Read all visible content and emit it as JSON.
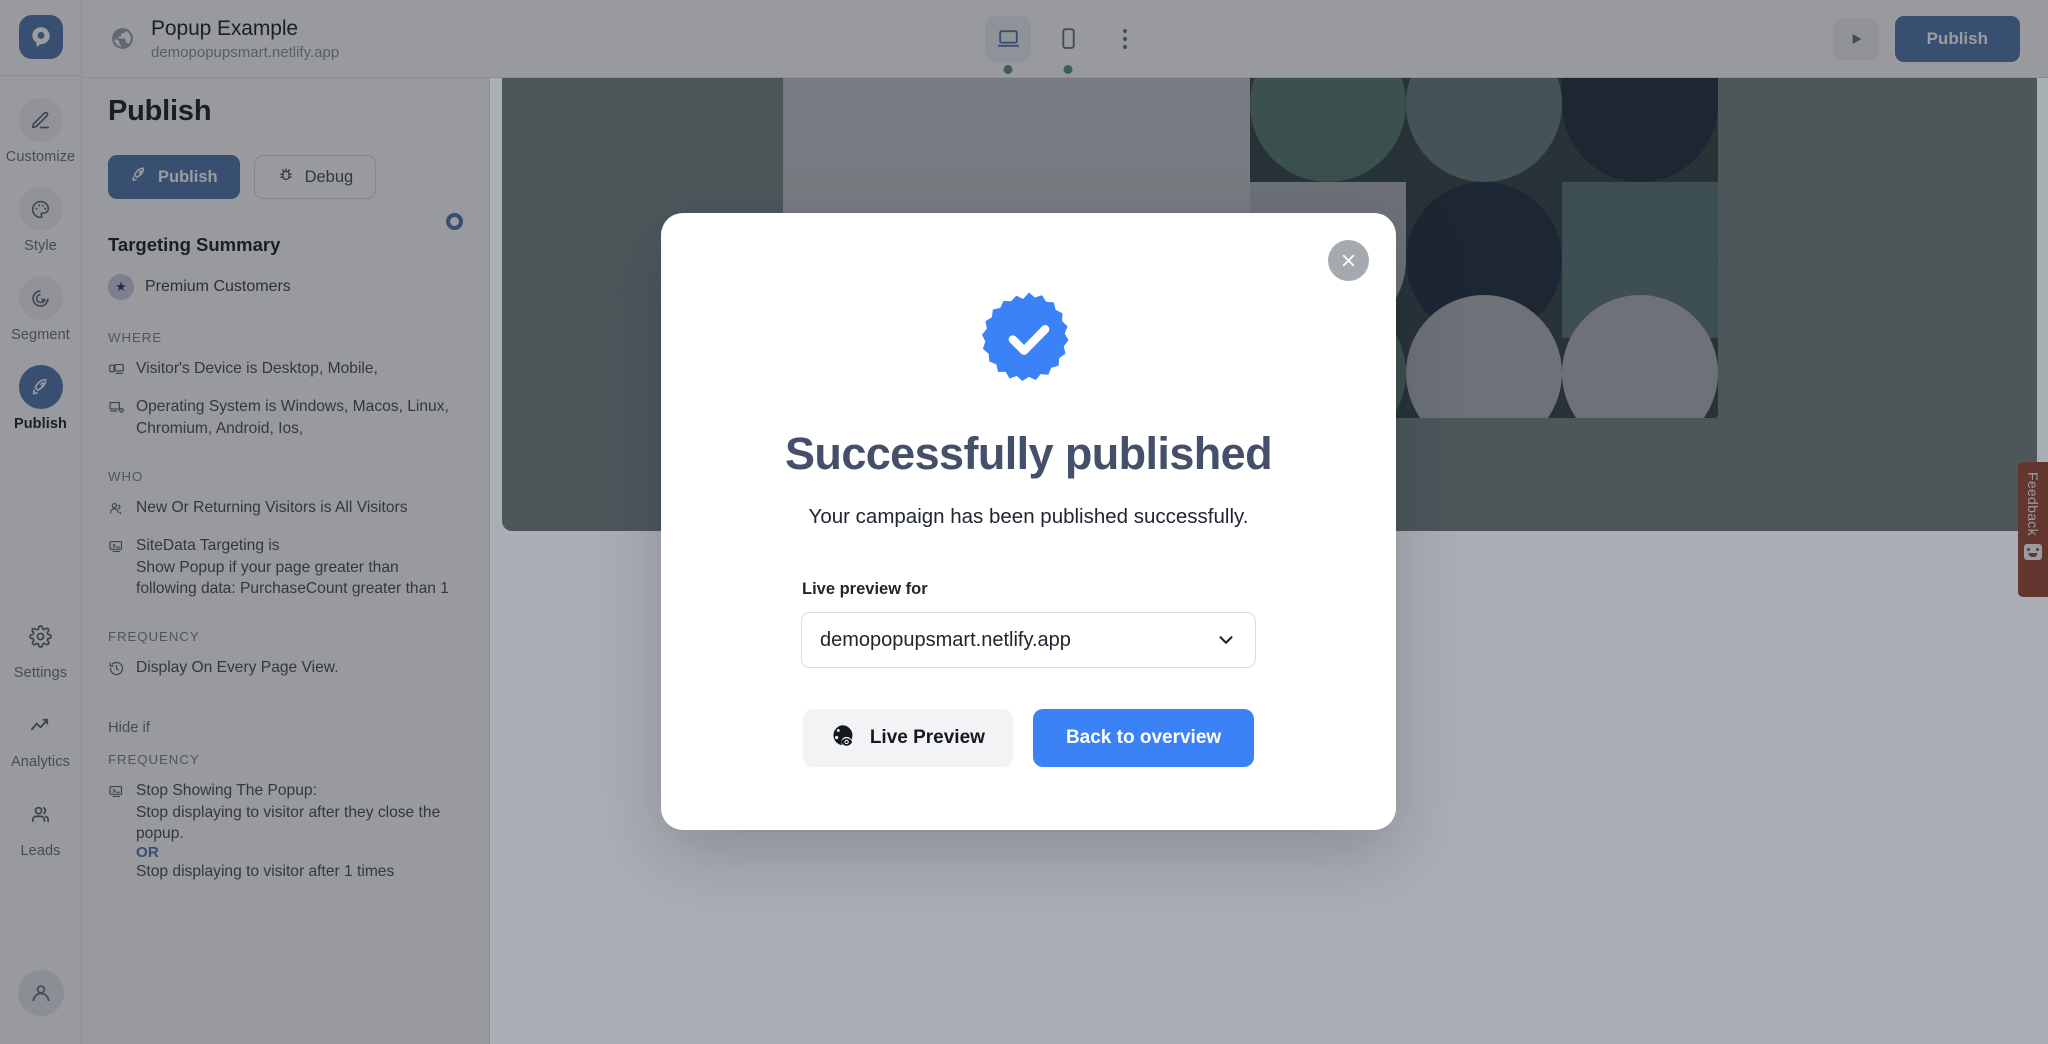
{
  "topbar": {
    "site_icon": "globe-icon",
    "title": "Popup Example",
    "subtitle": "demopopupsmart.netlify.app",
    "devices": [
      {
        "name": "desktop",
        "icon": "desktop-icon",
        "active": true,
        "status": "online"
      },
      {
        "name": "mobile",
        "icon": "mobile-icon",
        "active": false,
        "status": "online"
      }
    ],
    "more_icon": "kebab-menu-icon",
    "play_icon": "play-icon",
    "publish_label": "Publish"
  },
  "rail": {
    "brand_icon": "popupsmart-logo",
    "items": [
      {
        "label": "Customize",
        "icon": "pencil-icon",
        "active": false
      },
      {
        "label": "Style",
        "icon": "palette-icon",
        "active": false
      },
      {
        "label": "Segment",
        "icon": "target-cursor-icon",
        "active": false
      },
      {
        "label": "Publish",
        "icon": "rocket-icon",
        "active": true
      },
      {
        "label": "Settings",
        "icon": "gear-icon",
        "active": false
      },
      {
        "label": "Analytics",
        "icon": "chart-line-icon",
        "active": false
      },
      {
        "label": "Leads",
        "icon": "users-icon",
        "active": false
      }
    ],
    "avatar_icon": "user-avatar-icon"
  },
  "panel": {
    "heading": "Publish",
    "publish_button": "Publish",
    "publish_icon": "rocket-icon",
    "debug_button": "Debug",
    "debug_icon": "bug-icon",
    "targeting_title": "Targeting Summary",
    "audience": {
      "icon": "star-icon",
      "label": "Premium Customers"
    },
    "groups": [
      {
        "label": "WHERE",
        "rules": [
          {
            "icon": "devices-icon",
            "text": "Visitor's Device is Desktop, Mobile,",
            "sub": ""
          },
          {
            "icon": "os-monitor-icon",
            "text": "Operating System is Windows, Macos, Linux,",
            "sub": "Chromium, Android, Ios,"
          }
        ]
      },
      {
        "label": "WHO",
        "rules": [
          {
            "icon": "visitors-icon",
            "text": "New Or Returning Visitors is All Visitors",
            "sub": ""
          },
          {
            "icon": "sitedata-icon",
            "text": "SiteData Targeting is",
            "sub": "Show Popup if your page greater than following data: PurchaseCount greater than 1"
          }
        ]
      },
      {
        "label": "FREQUENCY",
        "rules": [
          {
            "icon": "clock-history-icon",
            "text": "Display On Every Page View.",
            "sub": ""
          }
        ]
      }
    ],
    "hide_if_label": "Hide if",
    "hide_frequency_label": "FREQUENCY",
    "hide_rule": {
      "icon": "sitedata-icon",
      "title": "Stop Showing The Popup:",
      "line1": "Stop displaying to visitor after they close the popup.",
      "or": "OR",
      "line2": "Stop displaying to visitor after 1 times"
    }
  },
  "preview": {
    "popup_close_icon": "close-icon",
    "background_color": "#6f8a88"
  },
  "modal": {
    "close_icon": "close-icon",
    "badge_icon": "verified-check-badge",
    "title": "Successfully published",
    "description": "Your campaign has been published successfully.",
    "field_label": "Live preview for",
    "select_value": "demopopupsmart.netlify.app",
    "select_chevron_icon": "chevron-down-icon",
    "live_preview_label": "Live Preview",
    "live_preview_icon": "globe-eye-icon",
    "back_to_overview_label": "Back to overview"
  },
  "feedback": {
    "label": "Feedback",
    "icon": "smiley-face-icon",
    "color": "#d64022"
  },
  "intercom": {
    "icon": "chat-bubble-icon",
    "color": "#2f3b52"
  },
  "colors": {
    "accent_blue": "#3b7ddd",
    "modal_blue": "#3b82f6",
    "status_green": "#37a169",
    "heading_navy": "#44506a"
  }
}
